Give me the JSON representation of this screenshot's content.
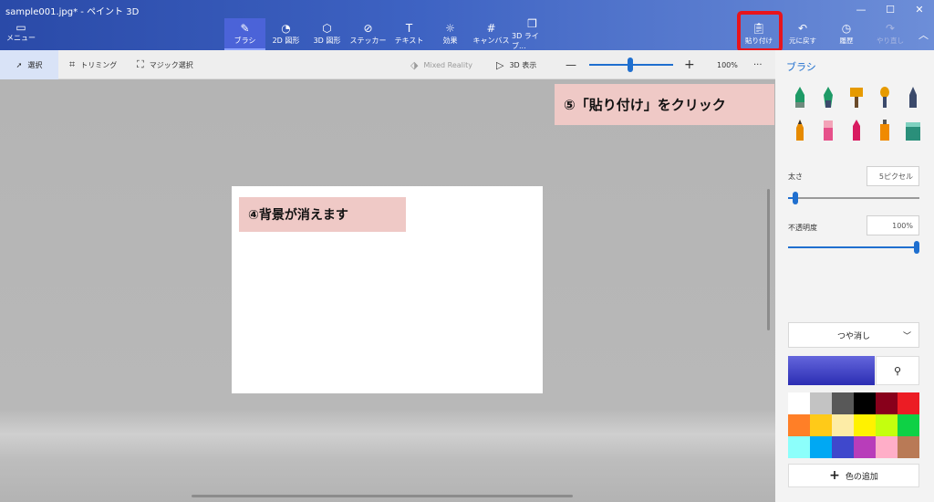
{
  "window": {
    "title": "sample001.jpg* - ペイント 3D",
    "controls": [
      "—",
      "☐",
      "✕"
    ]
  },
  "menu": {
    "icon": "menu-icon",
    "label": "メニュー"
  },
  "tools": [
    {
      "label": "ブラシ",
      "icon": "brush-icon",
      "active": true
    },
    {
      "label": "2D 図形",
      "icon": "2d-shapes-icon"
    },
    {
      "label": "3D 図形",
      "icon": "3d-shapes-icon"
    },
    {
      "label": "ステッカー",
      "icon": "sticker-icon"
    },
    {
      "label": "テキスト",
      "icon": "text-icon"
    },
    {
      "label": "効果",
      "icon": "effects-icon"
    },
    {
      "label": "キャンバス",
      "icon": "canvas-icon"
    },
    {
      "label": "3D ライブ...",
      "icon": "3d-library-icon"
    }
  ],
  "right_tools": [
    {
      "label": "貼り付け",
      "icon": "paste-icon"
    },
    {
      "label": "元に戻す",
      "icon": "undo-icon"
    },
    {
      "label": "履歴",
      "icon": "history-icon"
    },
    {
      "label": "やり直し",
      "icon": "redo-icon",
      "disabled": true
    }
  ],
  "toolbar2": {
    "select": "選択",
    "crop": "トリミング",
    "magic_select": "マジック選択",
    "mixed_reality": "Mixed Reality",
    "view3d": "3D 表示",
    "zoom_minus": "—",
    "zoom_plus": "+",
    "zoom": "100%",
    "more": "···",
    "zoom_level": 0.45
  },
  "panel": {
    "title": "ブラシ",
    "brushes": [
      {
        "icon": "marker-icon",
        "color": "#1e9a66"
      },
      {
        "icon": "calligraphy-pen-icon",
        "color": "#1e9a66"
      },
      {
        "icon": "oil-brush-icon",
        "color": "#e69a00"
      },
      {
        "icon": "watercolor-icon",
        "color": "#e69a00"
      },
      {
        "icon": "pixel-pen-icon",
        "color": "#3b4a6b"
      },
      {
        "icon": "pencil-icon",
        "color": "#e68a00"
      },
      {
        "icon": "eraser-icon",
        "color": "#e6508a"
      },
      {
        "icon": "crayon-icon",
        "color": "#d81b60"
      },
      {
        "icon": "spray-can-icon",
        "color": "#f08a00"
      },
      {
        "icon": "fill-icon",
        "color": "#2a8f7a"
      }
    ],
    "thickness_label": "太さ",
    "thickness_value": "5ピクセル",
    "opacity_label": "不透明度",
    "opacity_value": "100%",
    "finish": "つや消し",
    "palette": [
      "#ffffff",
      "#c3c3c3",
      "#585858",
      "#000000",
      "#88001b",
      "#ec1c24",
      "#ff7f27",
      "#ffca18",
      "#fdeca6",
      "#fff200",
      "#c4ff0e",
      "#0ed145",
      "#8cfffb",
      "#00a8f3",
      "#3f48cc",
      "#b83dba",
      "#ffaec8",
      "#b97a56"
    ],
    "current_color": "#3f48cc",
    "add_color": "色の追加"
  },
  "annotations": {
    "step4": "④背景が消えます",
    "step5": "⑤「貼り付け」をクリック"
  }
}
